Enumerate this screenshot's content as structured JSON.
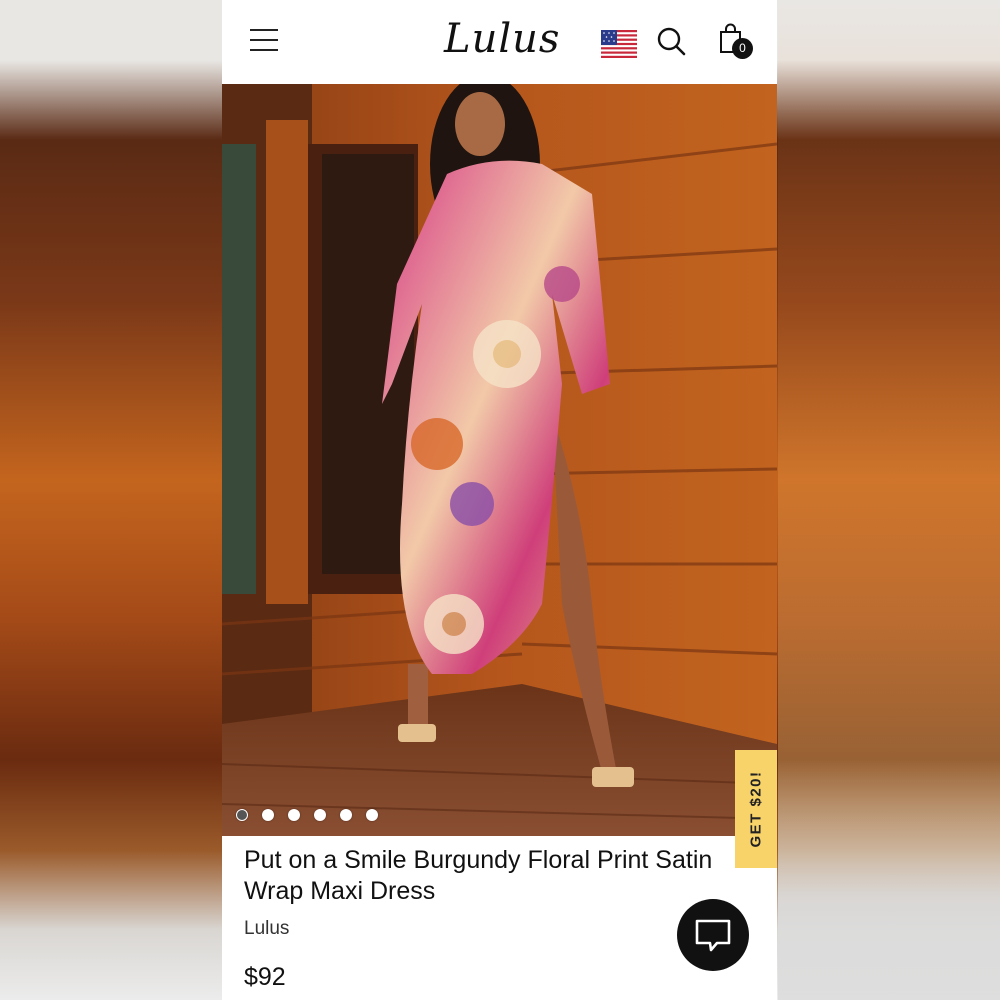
{
  "header": {
    "logo_text": "Lulus",
    "menu_icon": "hamburger-menu-icon",
    "flag_icon": "us-flag-icon",
    "search_icon": "search-icon",
    "bag_icon": "shopping-bag-icon",
    "bag_count": "0"
  },
  "gallery": {
    "image_count": 6,
    "active_index": 0,
    "promo_label": "GET $20!"
  },
  "product": {
    "title": "Put on a Smile Burgundy Floral Print Satin Wrap Maxi Dress",
    "brand": "Lulus",
    "price": "$92"
  },
  "chat": {
    "icon": "chat-bubble-icon"
  },
  "colors": {
    "promo": "#f8d36a",
    "text": "#111111",
    "chat_bg": "#111111"
  }
}
